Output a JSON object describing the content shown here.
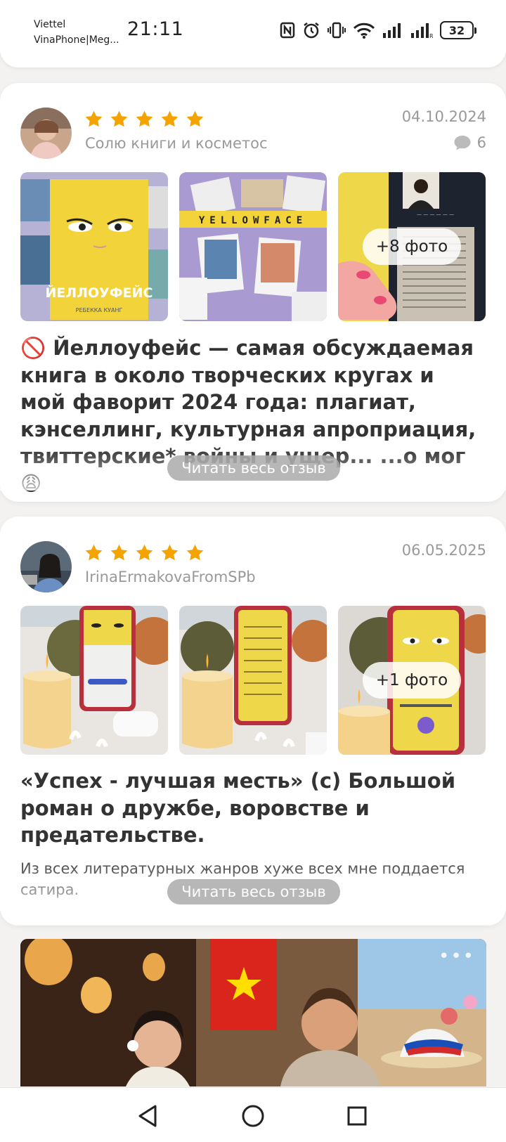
{
  "status_bar": {
    "carrier_1": "Viettel",
    "carrier_2": "VinaPhone|Meg...",
    "time": "21:11",
    "battery": "32",
    "icons": [
      "nfc-icon",
      "alarm-icon",
      "vibrate-icon",
      "wifi-icon",
      "signal-icon",
      "signal-roaming-icon"
    ]
  },
  "reviews": [
    {
      "username": "Солю книги и косметос",
      "rating": 5,
      "date": "04.10.2024",
      "comments_count": "6",
      "more_photos_label": "+8 фото",
      "text": "🚫 Йеллоуфейс — самая обсуждаемая книга в около творческих кругах и мой фаворит 2024 года: плагиат, кэнселлинг, культурная апроприация, твиттерские* войны и ущер... ...о мог 😩",
      "read_more_label": "Читать весь отзыв",
      "photo_captions": [
        "ЙЕЛЛОУФЕЙС",
        "РЕБЕККА КУАНГ",
        "YELLOWFACE"
      ]
    },
    {
      "username": "IrinaErmakovaFromSPb",
      "rating": 5,
      "date": "06.05.2025",
      "more_photos_label": "+1 фото",
      "text": "«Успех - лучшая месть» (с) Большой роман о дружбе, воровстве и предательстве.",
      "subtext": "Из всех литературных жанров хуже всех мне поддается сатира.",
      "read_more_label": "Читать весь отзыв"
    }
  ],
  "banner": {
    "more_icon": "ellipsis-icon"
  },
  "nav_bar": {
    "icons": [
      "back-icon",
      "home-icon",
      "recents-icon"
    ]
  },
  "colors": {
    "star": "#f5a300",
    "muted_text": "#999999",
    "read_more_bg": "#aaaaaa"
  }
}
